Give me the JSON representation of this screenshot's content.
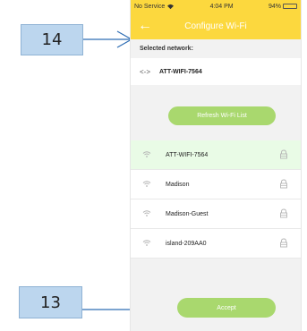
{
  "callouts": {
    "top_number": "14",
    "bottom_number": "13"
  },
  "status_bar": {
    "carrier": "No Service",
    "time": "4:04 PM",
    "battery": "94%"
  },
  "navbar": {
    "title": "Configure Wi-Fi",
    "back_icon": "arrow-left-icon"
  },
  "selected_network": {
    "header": "Selected network:",
    "name": "ATT-WIFI-7564"
  },
  "refresh_button": {
    "label": "Refresh Wi-Fi List"
  },
  "networks": [
    {
      "name": "ATT-WIFI-7564",
      "selected": true,
      "locked": true
    },
    {
      "name": "Madison",
      "selected": false,
      "locked": true
    },
    {
      "name": "Madison-Guest",
      "selected": false,
      "locked": true
    },
    {
      "name": "island-209AA0",
      "selected": false,
      "locked": true
    }
  ],
  "accept_button": {
    "label": "Accept"
  },
  "colors": {
    "header_yellow": "#fcd83e",
    "button_green": "#a9d86e",
    "selected_row": "#e9fbe6",
    "callout_blue": "#bcd6ee",
    "arrow_blue": "#2e6db4"
  }
}
